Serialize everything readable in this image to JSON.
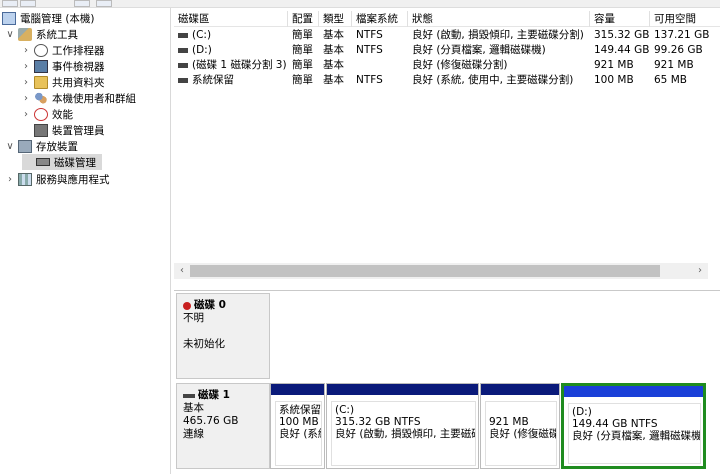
{
  "tree": {
    "items": [
      {
        "label": "電腦管理 (本機)",
        "expander": "",
        "icon": "computer-icon"
      },
      {
        "label": "系統工具",
        "expander": "∨",
        "icon": "tools-icon"
      },
      {
        "label": "工作排程器",
        "expander": "›",
        "icon": "clock-icon"
      },
      {
        "label": "事件檢視器",
        "expander": "›",
        "icon": "event-viewer-icon"
      },
      {
        "label": "共用資料夾",
        "expander": "›",
        "icon": "shared-folder-icon"
      },
      {
        "label": "本機使用者和群組",
        "expander": "›",
        "icon": "users-icon"
      },
      {
        "label": "效能",
        "expander": "›",
        "icon": "performance-icon"
      },
      {
        "label": "裝置管理員",
        "expander": "",
        "icon": "device-manager-icon"
      },
      {
        "label": "存放裝置",
        "expander": "∨",
        "icon": "storage-icon"
      },
      {
        "label": "磁碟管理",
        "expander": "",
        "icon": "disk-management-icon"
      },
      {
        "label": "服務與應用程式",
        "expander": "›",
        "icon": "services-icon"
      }
    ]
  },
  "volumes": {
    "headers": [
      "磁碟區",
      "配置",
      "類型",
      "檔案系統",
      "狀態",
      "容量",
      "可用空間"
    ],
    "rows": [
      [
        "(C:)",
        "簡單",
        "基本",
        "NTFS",
        "良好 (啟動, 損毀傾印, 主要磁碟分割)",
        "315.32 GB",
        "137.21 GB"
      ],
      [
        "(D:)",
        "簡單",
        "基本",
        "NTFS",
        "良好 (分頁檔案, 邏輯磁碟機)",
        "149.44 GB",
        "99.26 GB"
      ],
      [
        "(磁碟 1 磁碟分割 3)",
        "簡單",
        "基本",
        "",
        "良好 (修復磁碟分割)",
        "921 MB",
        "921 MB"
      ],
      [
        "系統保留",
        "簡單",
        "基本",
        "NTFS",
        "良好 (系統, 使用中, 主要磁碟分割)",
        "100 MB",
        "65 MB"
      ]
    ]
  },
  "scrollbar": {
    "left": "‹",
    "right": "›"
  },
  "disks": [
    {
      "name": "磁碟 0",
      "lines": [
        "不明",
        "",
        "未初始化"
      ]
    },
    {
      "name": "磁碟 1",
      "lines": [
        "基本",
        "465.76 GB",
        "連線"
      ]
    }
  ],
  "partitions": [
    {
      "name": "系統保留",
      "size": "100 MB",
      "status": "良好 (系統"
    },
    {
      "name": "(C:)",
      "size": "315.32 GB NTFS",
      "status": "良好 (啟動, 損毀傾印, 主要磁碟"
    },
    {
      "name": "",
      "size": "921 MB",
      "status": "良好 (修復磁碟"
    },
    {
      "name": "(D:)",
      "size": "149.44 GB NTFS",
      "status": "良好 (分頁檔案, 邏輯磁碟機"
    }
  ],
  "colors": {
    "primary_bar": "#0a1a7a",
    "selected_border": "#1f8c1f",
    "selected_bar": "#1a3fd8"
  }
}
